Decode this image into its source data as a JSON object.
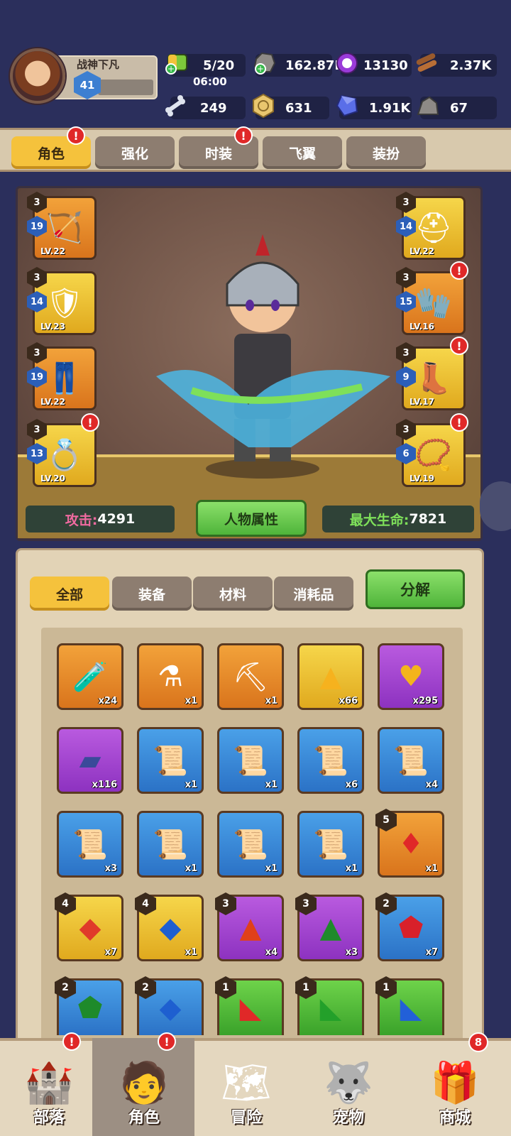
{
  "player": {
    "name": "战神下凡",
    "level": "41"
  },
  "resources": {
    "stamina": {
      "value": "5/20",
      "timer": "06:00",
      "icon": "stamina-icon"
    },
    "stone": {
      "value": "162.87K",
      "icon": "stone-icon"
    },
    "orb": {
      "value": "13130",
      "icon": "magic-orb-icon"
    },
    "wood": {
      "value": "2.37K",
      "icon": "wood-icon"
    },
    "bone": {
      "value": "249",
      "icon": "bone-icon"
    },
    "coin": {
      "value": "631",
      "icon": "coin-icon"
    },
    "gem": {
      "value": "1.91K",
      "icon": "gem-icon"
    },
    "ore": {
      "value": "67",
      "icon": "ore-icon"
    }
  },
  "tabs": [
    {
      "label": "角色",
      "alert": "!"
    },
    {
      "label": "强化",
      "alert": ""
    },
    {
      "label": "时装",
      "alert": "!"
    },
    {
      "label": "飞翼",
      "alert": ""
    },
    {
      "label": "装扮",
      "alert": ""
    }
  ],
  "equipment": {
    "left": [
      {
        "slot": "bow",
        "star": "3",
        "enhance": "19",
        "level": "LV.22"
      },
      {
        "slot": "armor",
        "star": "3",
        "enhance": "14",
        "level": "LV.23"
      },
      {
        "slot": "pants",
        "star": "3",
        "enhance": "19",
        "level": "LV.22"
      },
      {
        "slot": "ring",
        "star": "3",
        "enhance": "13",
        "level": "LV.20",
        "alert": "!"
      }
    ],
    "right": [
      {
        "slot": "helmet",
        "star": "3",
        "enhance": "14",
        "level": "LV.22"
      },
      {
        "slot": "gloves",
        "star": "3",
        "enhance": "15",
        "level": "LV.16",
        "alert": "!"
      },
      {
        "slot": "boots",
        "star": "3",
        "enhance": "9",
        "level": "LV.17",
        "alert": "!"
      },
      {
        "slot": "necklace",
        "star": "3",
        "enhance": "6",
        "level": "LV.19",
        "alert": "!"
      }
    ]
  },
  "stats": {
    "attack_label": "攻击:",
    "attack_value": "4291",
    "hp_label": "最大生命:",
    "hp_value": "7821",
    "attr_button": "人物属性"
  },
  "inventory": {
    "tabs": [
      "全部",
      "装备",
      "材料",
      "消耗品"
    ],
    "decompose": "分解",
    "items": [
      {
        "icon": "potion-icon",
        "rarity": "orange",
        "count": "x24",
        "star": ""
      },
      {
        "icon": "green-flask-icon",
        "rarity": "orange",
        "count": "x1",
        "star": ""
      },
      {
        "icon": "pickaxe-icon",
        "rarity": "orange",
        "count": "x1",
        "star": ""
      },
      {
        "icon": "gold-pile-icon",
        "rarity": "yellow",
        "count": "x66",
        "star": ""
      },
      {
        "icon": "gold-heart-icon",
        "rarity": "purple",
        "count": "x295",
        "star": ""
      },
      {
        "icon": "cloth-icon",
        "rarity": "purple",
        "count": "x116",
        "star": ""
      },
      {
        "icon": "scroll-icon",
        "rarity": "blue",
        "count": "x1",
        "star": ""
      },
      {
        "icon": "scroll-icon",
        "rarity": "blue",
        "count": "x1",
        "star": ""
      },
      {
        "icon": "scroll-icon",
        "rarity": "blue",
        "count": "x6",
        "star": ""
      },
      {
        "icon": "scroll-icon",
        "rarity": "blue",
        "count": "x4",
        "star": ""
      },
      {
        "icon": "scroll-icon",
        "rarity": "blue",
        "count": "x3",
        "star": ""
      },
      {
        "icon": "scroll-icon",
        "rarity": "blue",
        "count": "x1",
        "star": ""
      },
      {
        "icon": "scroll-icon",
        "rarity": "blue",
        "count": "x1",
        "star": ""
      },
      {
        "icon": "scroll-icon",
        "rarity": "blue",
        "count": "x1",
        "star": ""
      },
      {
        "icon": "red-crystal-icon",
        "rarity": "orange",
        "count": "x1",
        "star": "5"
      },
      {
        "icon": "red-gem-icon",
        "rarity": "yellow",
        "count": "x7",
        "star": "4"
      },
      {
        "icon": "blue-gem-icon",
        "rarity": "yellow",
        "count": "x1",
        "star": "4"
      },
      {
        "icon": "red-triangle-gem-icon",
        "rarity": "purple",
        "count": "x4",
        "star": "3"
      },
      {
        "icon": "green-triangle-gem-icon",
        "rarity": "purple",
        "count": "x3",
        "star": "3"
      },
      {
        "icon": "red-round-gem-icon",
        "rarity": "blue",
        "count": "x7",
        "star": "2"
      },
      {
        "icon": "green-gem-icon",
        "rarity": "blue",
        "count": "",
        "star": "2"
      },
      {
        "icon": "blue-gem-icon",
        "rarity": "blue",
        "count": "",
        "star": "2"
      },
      {
        "icon": "red-shard-icon",
        "rarity": "green",
        "count": "",
        "star": "1"
      },
      {
        "icon": "green-shard-icon",
        "rarity": "green",
        "count": "",
        "star": "1"
      },
      {
        "icon": "blue-shard-icon",
        "rarity": "green",
        "count": "",
        "star": "1"
      }
    ]
  },
  "nav": [
    {
      "label": "部落",
      "icon": "tribe-icon",
      "alert": "!"
    },
    {
      "label": "角色",
      "icon": "character-icon",
      "alert": "!"
    },
    {
      "label": "冒险",
      "icon": "map-icon",
      "alert": ""
    },
    {
      "label": "宠物",
      "icon": "pet-icon",
      "alert": ""
    },
    {
      "label": "商城",
      "icon": "shop-icon",
      "alert": "8"
    }
  ]
}
